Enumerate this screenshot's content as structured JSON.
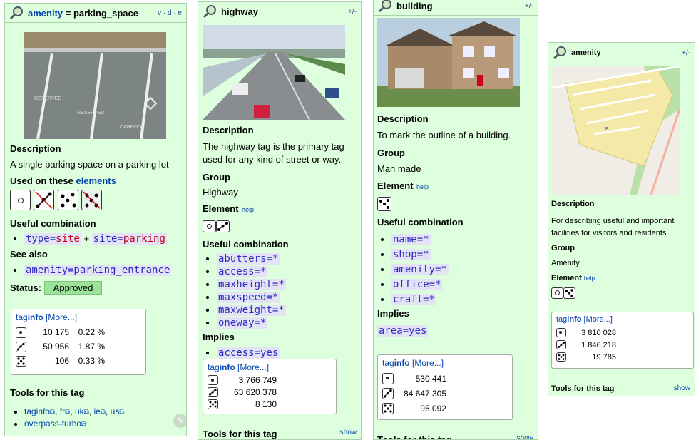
{
  "panel1": {
    "title_key": "amenity",
    "title_rest": " = parking_space",
    "vde": "v · d · e",
    "description_heading": "Description",
    "description": "A single parking space on a parking lot",
    "used_on_prefix": "Used on these ",
    "used_on_link": "elements",
    "useful_heading": "Useful combination",
    "combo_type_key": "type",
    "combo_type_val": "site",
    "combo_plus": "+",
    "combo_site_key": "site",
    "combo_site_val": "parking",
    "see_also_heading": "See also",
    "see_also": "amenity=parking_entrance",
    "status_label": "Status:",
    "status_value": "Approved",
    "taginfo_tag": "tag",
    "taginfo_info": "info",
    "taginfo_more": "[More...]",
    "stats": [
      {
        "count": "10 175",
        "pct": "0.22 %"
      },
      {
        "count": "50 956",
        "pct": "1.87 %"
      },
      {
        "count": "106",
        "pct": "0.33 %"
      }
    ],
    "tools_heading": "Tools for this tag",
    "tools": [
      "taginfo",
      "fr",
      "uk",
      "ie",
      "us"
    ],
    "overpass": "overpass-turbo",
    "image_labels": [
      "RESERVED",
      "RESERVED",
      "CARPOOL"
    ]
  },
  "panel2": {
    "title": "highway",
    "edit": "+/-",
    "description_heading": "Description",
    "description": "The highway tag is the primary tag used for any kind of street or way.",
    "group_heading": "Group",
    "group": "Highway",
    "element_heading": "Element",
    "help": "help",
    "useful_heading": "Useful combination",
    "combos": [
      "abutters=*",
      "access=*",
      "maxheight=*",
      "maxspeed=*",
      "maxweight=*",
      "oneway=*"
    ],
    "implies_heading": "Implies",
    "implies": "access=yes",
    "taginfo_tag": "tag",
    "taginfo_info": "info",
    "taginfo_more": "[More...]",
    "stats": [
      "3 766 749",
      "63 620 378",
      "8 130"
    ],
    "tools_heading": "Tools for this tag",
    "show": "show"
  },
  "panel3": {
    "title": "building",
    "edit": "+/-",
    "description_heading": "Description",
    "description": "To mark the outline of a building.",
    "group_heading": "Group",
    "group": "Man made",
    "element_heading": "Element",
    "help": "help",
    "useful_heading": "Useful combination",
    "combos": [
      "name=*",
      "shop=*",
      "amenity=*",
      "office=*",
      "craft=*"
    ],
    "implies_heading": "Implies",
    "implies": "area=yes",
    "taginfo_tag": "tag",
    "taginfo_info": "info",
    "taginfo_more": "[More...]",
    "stats": [
      "530 441",
      "84 647 305",
      "95 092"
    ],
    "tools_heading": "Tools for this tag",
    "show": "show"
  },
  "panel4": {
    "title": "amenity",
    "edit": "+/-",
    "map_label": "P",
    "description_heading": "Description",
    "description": "For describing useful and important facilities for visitors and residents.",
    "group_heading": "Group",
    "group": "Amenity",
    "element_heading": "Element",
    "help": "help",
    "taginfo_tag": "tag",
    "taginfo_info": "info",
    "taginfo_more": "[More...]",
    "stats": [
      "3 810 028",
      "1 846 218",
      "19 785"
    ],
    "tools_heading": "Tools for this tag",
    "show": "show"
  },
  "colors": {
    "panel_bg": "#ddffdd",
    "link": "#0645ad",
    "approved": "#9be29b"
  }
}
